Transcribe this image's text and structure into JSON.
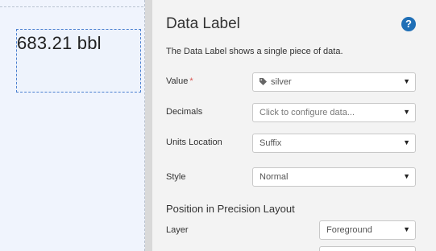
{
  "canvas": {
    "widget_value": "683.21 bbl"
  },
  "panel": {
    "title": "Data Label",
    "help_icon": "question-circle-icon",
    "description": "The Data Label shows a single piece of data.",
    "fields": {
      "value": {
        "label": "Value",
        "required_marker": "*",
        "selected": "silver",
        "icon": "tag-icon"
      },
      "decimals": {
        "label": "Decimals",
        "placeholder": "Click to configure data..."
      },
      "units_location": {
        "label": "Units Location",
        "selected": "Suffix"
      },
      "style": {
        "label": "Style",
        "selected": "Normal"
      }
    },
    "precision_layout": {
      "title": "Position in Precision Layout",
      "layer": {
        "label": "Layer",
        "selected": "Foreground"
      }
    }
  },
  "colors": {
    "accent": "#1f6fb6",
    "required": "#d9534f",
    "canvas_bg": "#f0f4fd",
    "selection_border": "#4a7fd0"
  }
}
